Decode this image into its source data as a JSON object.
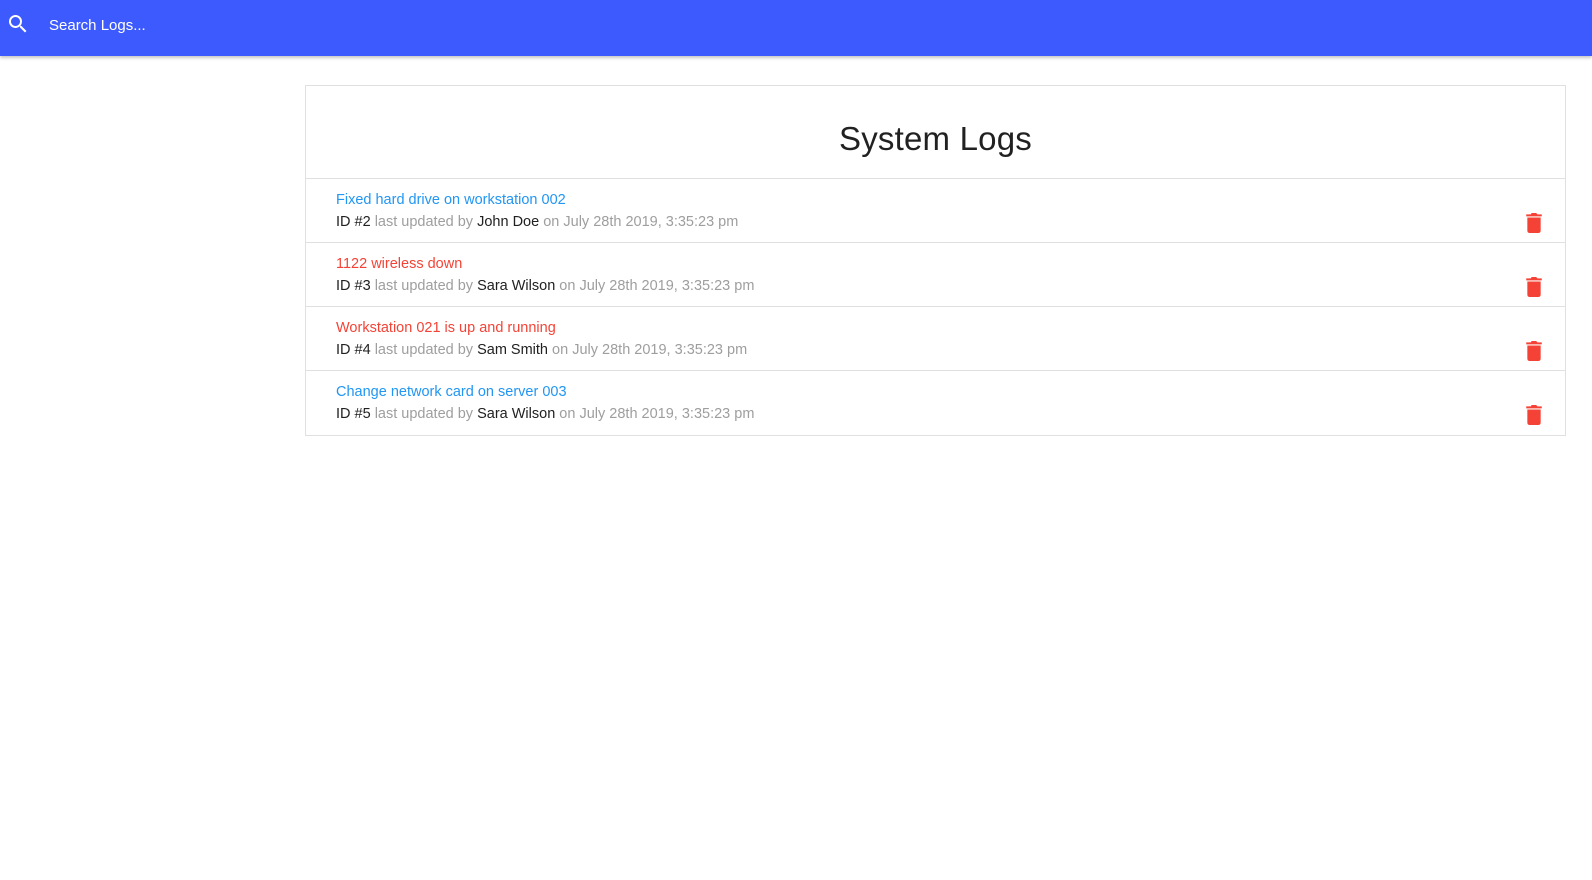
{
  "search": {
    "placeholder": "Search Logs..."
  },
  "page": {
    "title": "System Logs"
  },
  "labels": {
    "last_updated_by": "last updated by",
    "on": "on"
  },
  "colors": {
    "navbar": "#3d5afe",
    "normal_message": "#2196f3",
    "attention_message": "#f44336",
    "delete_icon": "#f44336"
  },
  "logs": [
    {
      "message": "Fixed hard drive on workstation 002",
      "attention": false,
      "id_text": "ID #2",
      "tech": "John Doe",
      "date": "July 28th 2019, 3:35:23 pm"
    },
    {
      "message": "1122 wireless down",
      "attention": true,
      "id_text": "ID #3",
      "tech": "Sara Wilson",
      "date": "July 28th 2019, 3:35:23 pm"
    },
    {
      "message": "Workstation 021 is up and running",
      "attention": true,
      "id_text": "ID #4",
      "tech": "Sam Smith",
      "date": "July 28th 2019, 3:35:23 pm"
    },
    {
      "message": "Change network card on server 003",
      "attention": false,
      "id_text": "ID #5",
      "tech": "Sara Wilson",
      "date": "July 28th 2019, 3:35:23 pm"
    }
  ]
}
